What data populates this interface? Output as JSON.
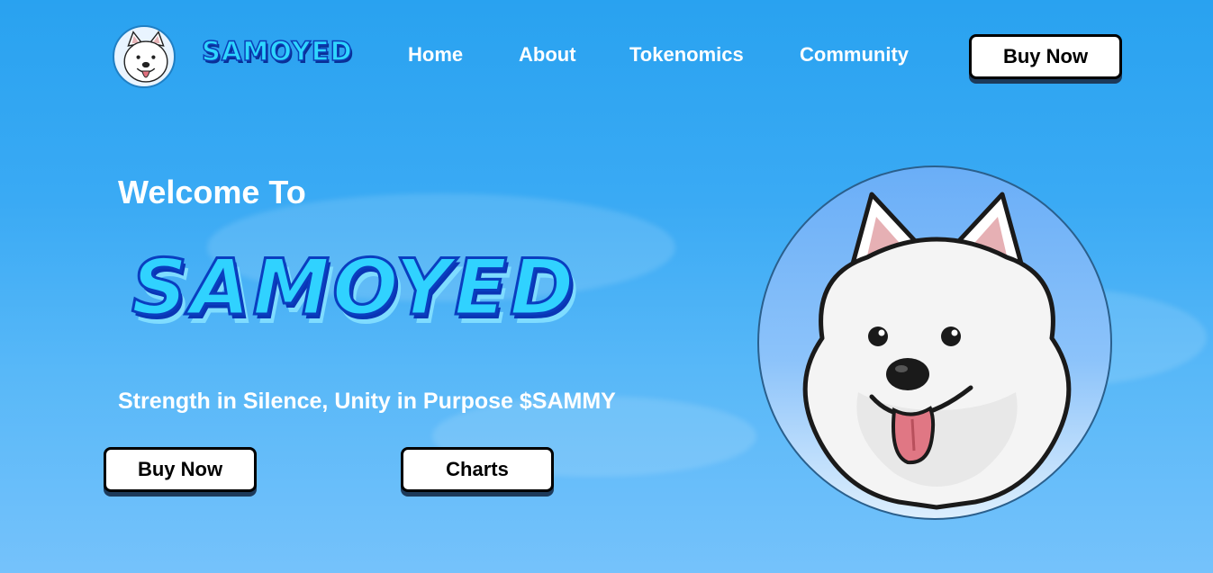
{
  "brand": {
    "logo_text": "SAMOYED",
    "logo_icon": "samoyed-dog-icon"
  },
  "nav": {
    "items": [
      {
        "label": "Home"
      },
      {
        "label": "About"
      },
      {
        "label": "Tokenomics"
      },
      {
        "label": "Community"
      }
    ],
    "cta_label": "Buy Now"
  },
  "hero": {
    "welcome": "Welcome To",
    "title": "SAMOYED",
    "tagline": "Strength in Silence, Unity in Purpose $SAMMY",
    "buy_label": "Buy Now",
    "charts_label": "Charts"
  },
  "mascot": {
    "icon": "samoyed-dog-icon"
  },
  "colors": {
    "background_top": "#29a2f0",
    "background_bottom": "#75c2fb",
    "logo_fill": "#2fd6ff",
    "logo_outline": "#0a3ec0",
    "button_bg": "#ffffff",
    "button_border": "#000000"
  }
}
